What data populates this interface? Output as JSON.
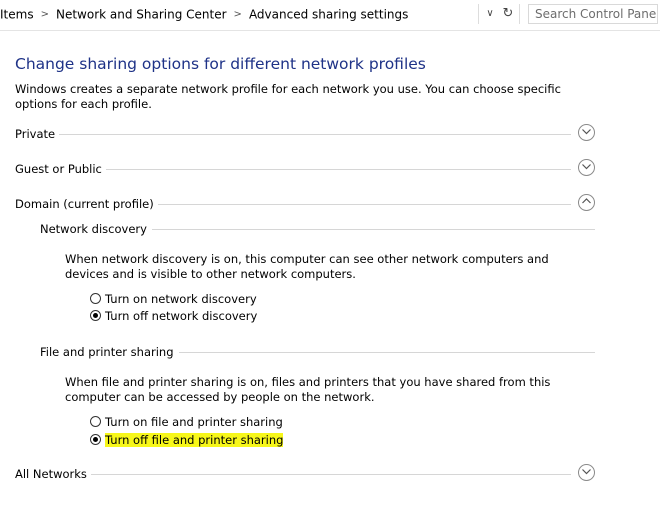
{
  "address_bar": {
    "crumbs": [
      "Items",
      "Network and Sharing Center",
      "Advanced sharing settings"
    ],
    "search_placeholder": "Search Control Panel"
  },
  "heading": "Change sharing options for different network profiles",
  "intro": "Windows creates a separate network profile for each network you use. You can choose specific options for each profile.",
  "profiles": {
    "private": "Private",
    "guest": "Guest or Public",
    "domain": "Domain (current profile)",
    "all": "All Networks"
  },
  "network_discovery": {
    "title": "Network discovery",
    "description": "When network discovery is on, this computer can see other network computers and devices and is visible to other network computers.",
    "options": [
      "Turn on network discovery",
      "Turn off network discovery"
    ],
    "selected": 1
  },
  "file_printer_sharing": {
    "title": "File and printer sharing",
    "description": "When file and printer sharing is on, files and printers that you have shared from this computer can be accessed by people on the network.",
    "options": [
      "Turn on file and printer sharing",
      "Turn off file and printer sharing"
    ],
    "selected": 1
  },
  "colors": {
    "heading": "#1e3287",
    "highlight": "#f7f71a"
  },
  "icons": {
    "expand": "chevron-down-icon",
    "collapse": "chevron-up-icon",
    "dropdown": "dropdown-arrow-icon",
    "refresh": "refresh-icon"
  }
}
